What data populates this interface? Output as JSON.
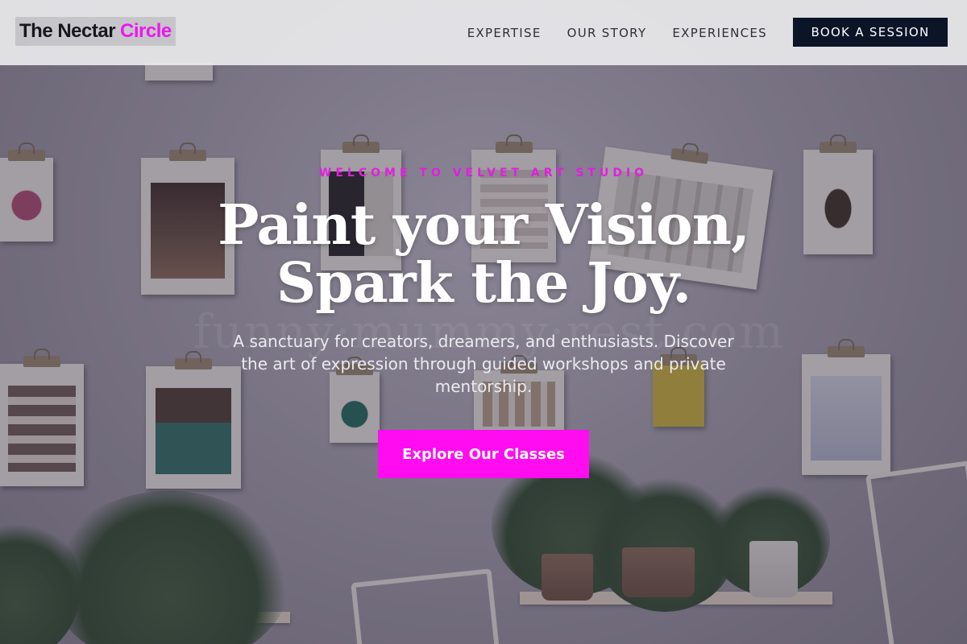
{
  "brand": {
    "name_part1": "The Nectar",
    "name_part2": "Circle",
    "accent_color": "#ee16ee"
  },
  "nav": {
    "links": [
      {
        "label": "EXPERTISE"
      },
      {
        "label": "OUR STORY"
      },
      {
        "label": "EXPERIENCES"
      }
    ],
    "cta_label": "BOOK A SESSION"
  },
  "hero": {
    "eyebrow": "WELCOME TO VELVET ART STUDIO",
    "headline_line1": "Paint your Vision,",
    "headline_line2": "Spark the Joy.",
    "subtitle": "A sanctuary for creators, dreamers, and enthusiasts. Discover the art of expression through guided workshops and private mentorship.",
    "cta_label": "Explore Our Classes",
    "cta_color": "#ff0cf0",
    "background_image": "art studio wall with clipboards and plants"
  }
}
